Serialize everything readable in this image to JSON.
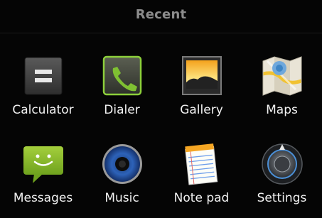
{
  "dialog": {
    "title": "Recent"
  },
  "apps": [
    {
      "label": "Calculator",
      "icon": "calculator-icon"
    },
    {
      "label": "Dialer",
      "icon": "phone-icon"
    },
    {
      "label": "Gallery",
      "icon": "gallery-icon"
    },
    {
      "label": "Maps",
      "icon": "map-icon"
    },
    {
      "label": "Messages",
      "icon": "message-bubble-icon"
    },
    {
      "label": "Music",
      "icon": "speaker-icon"
    },
    {
      "label": "Note pad",
      "icon": "notepad-icon"
    },
    {
      "label": "Settings",
      "icon": "settings-knob-icon"
    }
  ],
  "colors": {
    "background": "#050505",
    "title": "#8c8c8c",
    "label": "#f2f2f2",
    "dialer_green": "#7fc032",
    "messages_green": "#8fbe2a"
  }
}
